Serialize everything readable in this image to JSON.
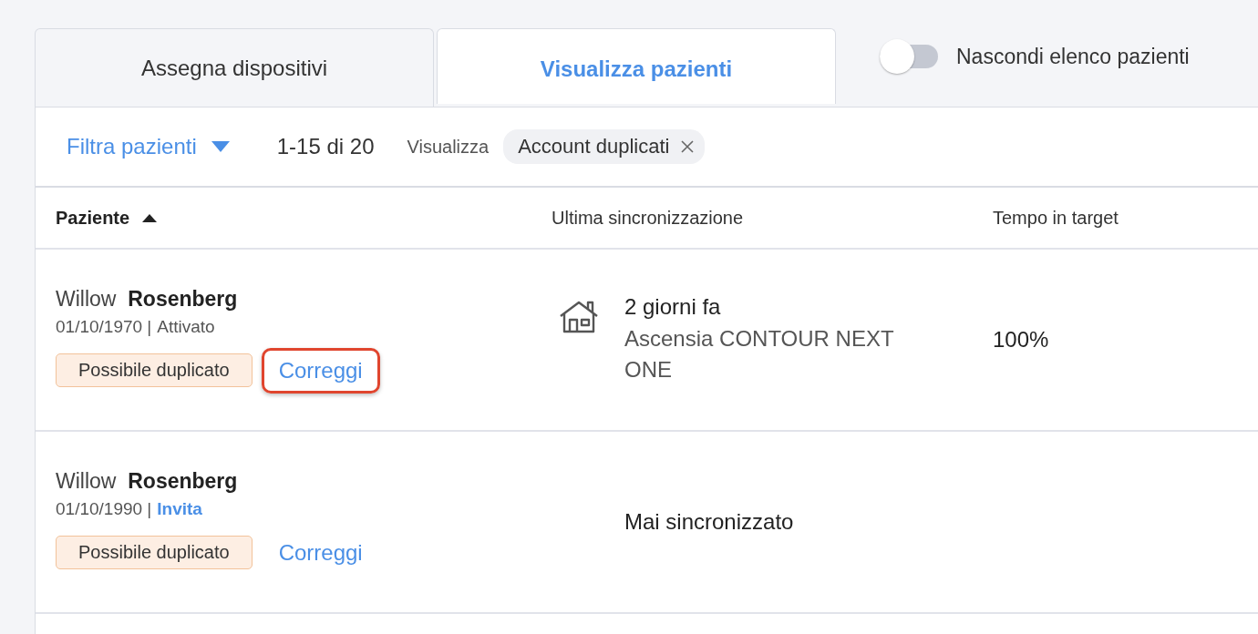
{
  "tabs": [
    {
      "label": "Assegna dispositivi",
      "selected": false
    },
    {
      "label": "Visualizza pazienti",
      "selected": true
    }
  ],
  "toggle": {
    "label": "Nascondi elenco pazienti",
    "on": false
  },
  "toolbar": {
    "filter_label": "Filtra pazienti",
    "range": "1-15 di 20",
    "view_label": "Visualizza",
    "chip": "Account duplicati"
  },
  "table": {
    "columns": [
      {
        "label": "Paziente",
        "sorted": true
      },
      {
        "label": "Ultima sincronizzazione",
        "sorted": false
      },
      {
        "label": "Tempo in target",
        "sorted": false
      }
    ],
    "rows": [
      {
        "first_name": "Willow",
        "last_name": "Rosenberg",
        "birth_date": "01/10/1970 |",
        "status": "Attivato",
        "status_link": false,
        "badge": "Possibile duplicato",
        "action": "Correggi",
        "highlighted": true,
        "synced_at_home": true,
        "sync_time": "2 giorni fa",
        "device": "Ascensia CONTOUR NEXT ONE",
        "time_in_target": "100%"
      },
      {
        "first_name": "Willow",
        "last_name": "Rosenberg",
        "birth_date": "01/10/1990 |",
        "status": "Invita",
        "status_link": true,
        "badge": "Possibile duplicato",
        "action": "Correggi",
        "highlighted": false,
        "synced_at_home": false,
        "sync_time": "Mai sincronizzato"
      }
    ]
  }
}
